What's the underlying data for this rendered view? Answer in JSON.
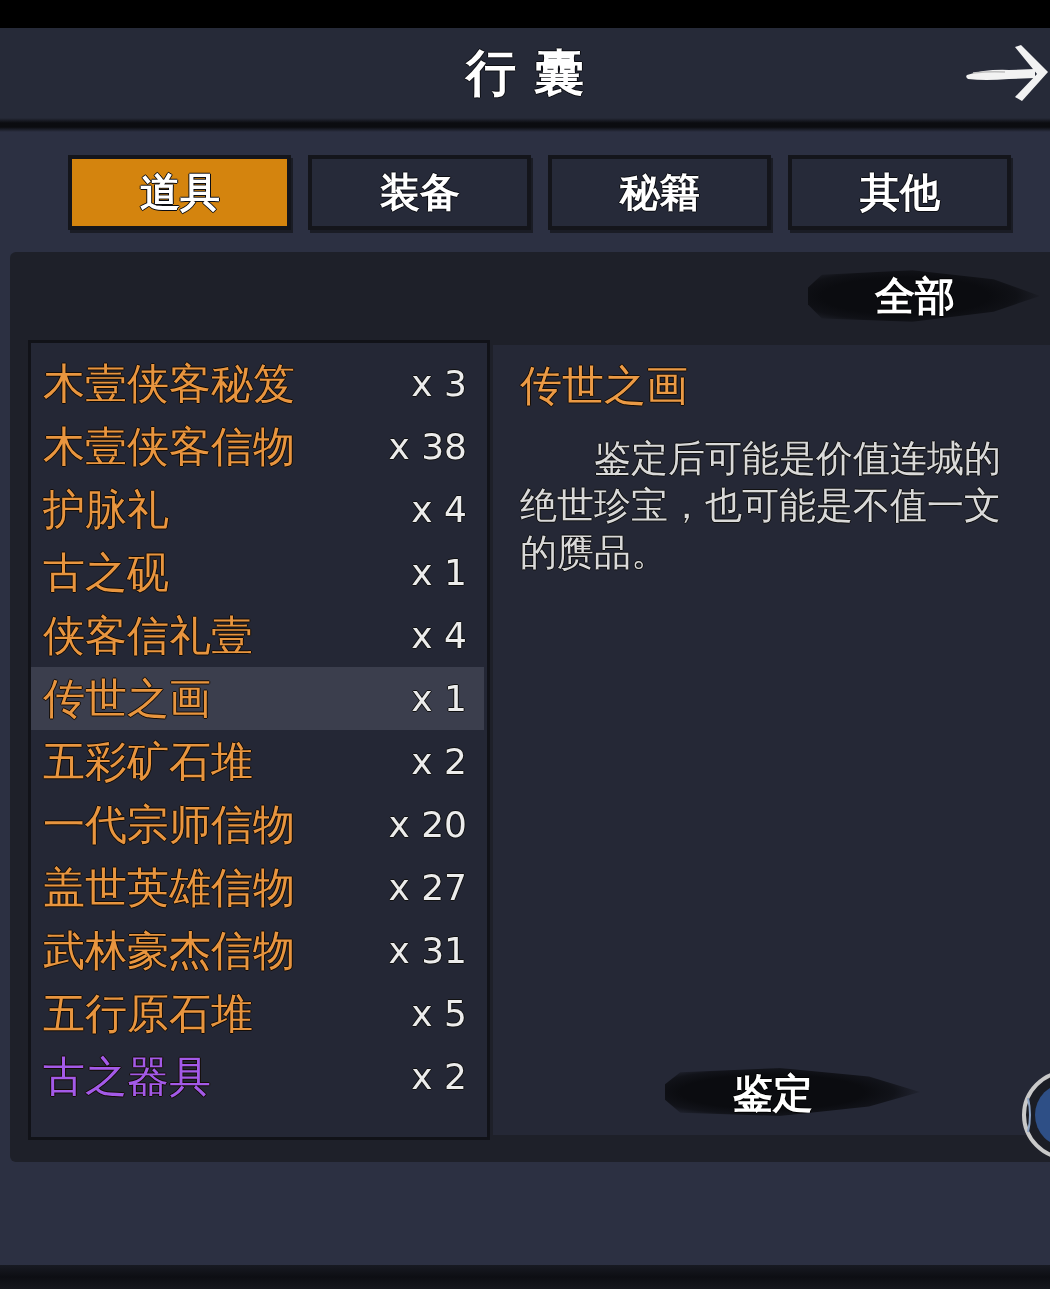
{
  "header": {
    "title": "行囊"
  },
  "tabs": [
    {
      "label": "道具",
      "selected": true
    },
    {
      "label": "装备",
      "selected": false
    },
    {
      "label": "秘籍",
      "selected": false
    },
    {
      "label": "其他",
      "selected": false
    }
  ],
  "filter": {
    "label": "全部"
  },
  "items": [
    {
      "name": "木壹侠客秘笈",
      "count": "x 3",
      "color": "#e8953f",
      "selected": false
    },
    {
      "name": "木壹侠客信物",
      "count": "x 38",
      "color": "#e8953f",
      "selected": false
    },
    {
      "name": "护脉礼",
      "count": "x 4",
      "color": "#e8953f",
      "selected": false
    },
    {
      "name": "古之砚",
      "count": "x 1",
      "color": "#e8953f",
      "selected": false
    },
    {
      "name": "侠客信礼壹",
      "count": "x 4",
      "color": "#e8953f",
      "selected": false
    },
    {
      "name": "传世之画",
      "count": "x 1",
      "color": "#e8953f",
      "selected": true
    },
    {
      "name": "五彩矿石堆",
      "count": "x 2",
      "color": "#e8953f",
      "selected": false
    },
    {
      "name": "一代宗师信物",
      "count": "x 20",
      "color": "#e8953f",
      "selected": false
    },
    {
      "name": "盖世英雄信物",
      "count": "x 27",
      "color": "#e8953f",
      "selected": false
    },
    {
      "name": "武林豪杰信物",
      "count": "x 31",
      "color": "#e8953f",
      "selected": false
    },
    {
      "name": "五行原石堆",
      "count": "x 5",
      "color": "#e8953f",
      "selected": false
    },
    {
      "name": "古之器具",
      "count": "x 2",
      "color": "#a35ae8",
      "selected": false
    }
  ],
  "detail": {
    "title": "传世之画",
    "description": "鉴定后可能是价值连城的绝世珍宝，也可能是不值一文的赝品。",
    "action": "鉴定"
  }
}
